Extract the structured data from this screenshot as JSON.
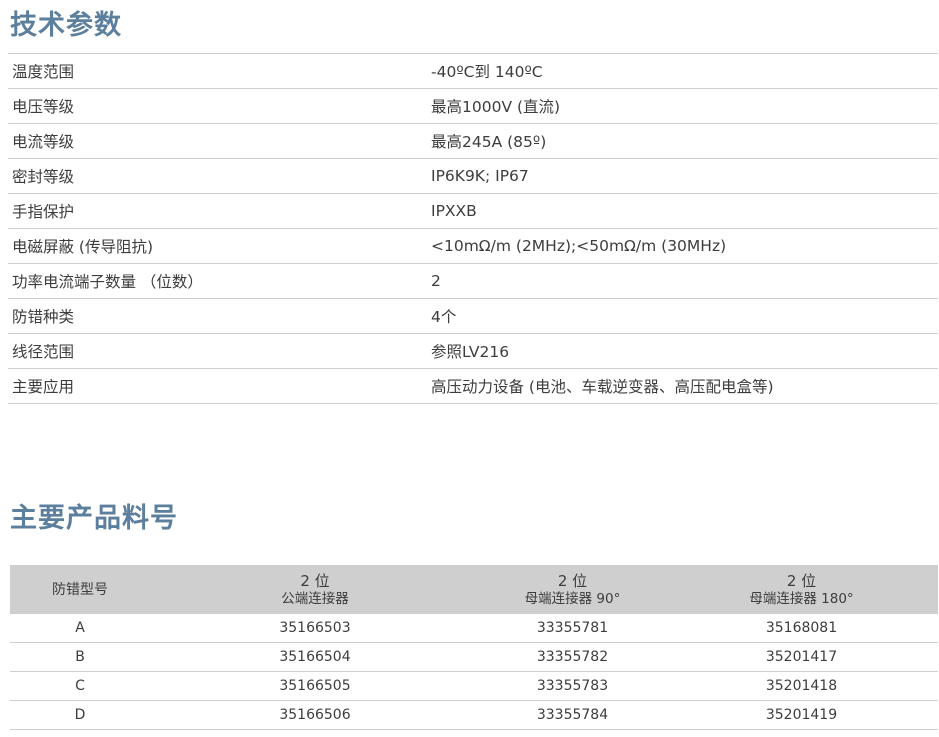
{
  "spec": {
    "title": "技术参数",
    "rows": [
      {
        "label": "温度范围",
        "value": "-40ºC到 140ºC"
      },
      {
        "label": "电压等级",
        "value": "最高1000V (直流)"
      },
      {
        "label": "电流等级",
        "value": "最高245A (85º)"
      },
      {
        "label": "密封等级",
        "value": "IP6K9K; IP67"
      },
      {
        "label": "手指保护",
        "value": "IPXXB"
      },
      {
        "label": "电磁屏蔽 (传导阻抗)",
        "value": "<10mΩ/m (2MHz);<50mΩ/m (30MHz)"
      },
      {
        "label": "功率电流端子数量 （位数）",
        "value": "2"
      },
      {
        "label": "防错种类",
        "value": "4个"
      },
      {
        "label": "线径范围",
        "value": "参照LV216"
      },
      {
        "label": "主要应用",
        "value": "高压动力设备 (电池、车载逆变器、高压配电盒等)"
      }
    ]
  },
  "parts": {
    "title": "主要产品料号",
    "header": {
      "col1": "防错型号",
      "col2_pos": "2 位",
      "col2_sub": "公端连接器",
      "col3_pos": "2 位",
      "col3_sub": "母端连接器 90°",
      "col4_pos": "2 位",
      "col4_sub": "母端连接器 180°"
    },
    "rows": [
      {
        "code": "A",
        "male": "35166503",
        "female90": "33355781",
        "female180": "35168081"
      },
      {
        "code": "B",
        "male": "35166504",
        "female90": "33355782",
        "female180": "35201417"
      },
      {
        "code": "C",
        "male": "35166505",
        "female90": "33355783",
        "female180": "35201418"
      },
      {
        "code": "D",
        "male": "35166506",
        "female90": "33355784",
        "female180": "35201419"
      }
    ]
  }
}
